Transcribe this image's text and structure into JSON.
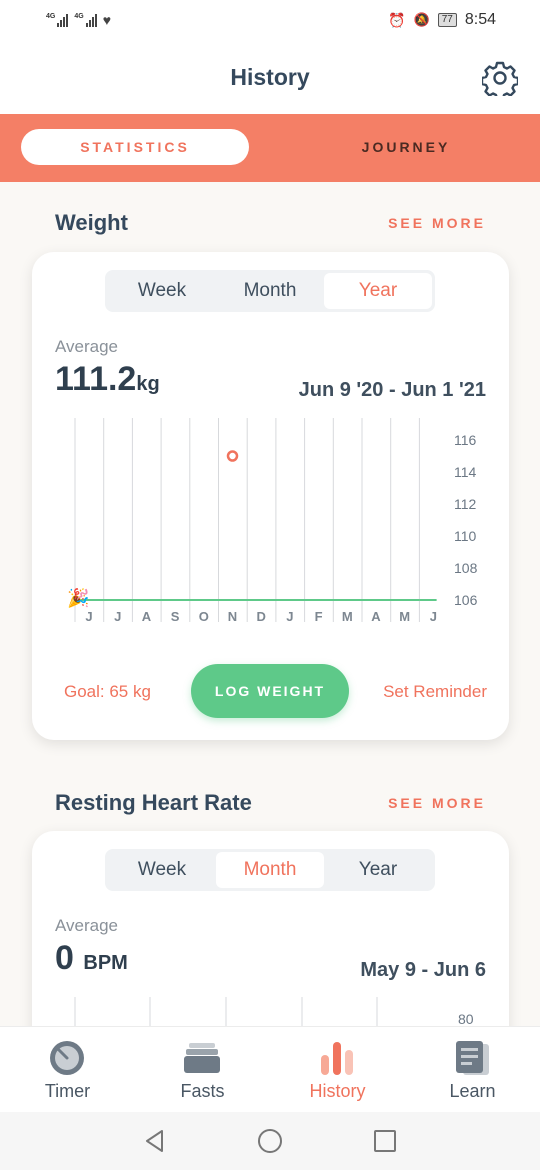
{
  "status_bar": {
    "sim1": "4G",
    "sim2": "4G",
    "battery": "77",
    "time": "8:54"
  },
  "header": {
    "title": "History"
  },
  "tabs": {
    "statistics": "STATISTICS",
    "journey": "JOURNEY"
  },
  "weight": {
    "title": "Weight",
    "see_more": "SEE MORE",
    "segments": [
      "Week",
      "Month",
      "Year"
    ],
    "selected_segment": "Year",
    "average_label": "Average",
    "average_value": "111.2",
    "average_unit": "kg",
    "date_range": "Jun 9 '20 - Jun 1 '21",
    "goal": "Goal: 65 kg",
    "log_button": "LOG WEIGHT",
    "set_reminder": "Set Reminder"
  },
  "chart_data": {
    "type": "line",
    "categories": [
      "J",
      "J",
      "A",
      "S",
      "O",
      "N",
      "D",
      "J",
      "F",
      "M",
      "A",
      "M",
      "J"
    ],
    "y_ticks": [
      116,
      114,
      112,
      110,
      108,
      106
    ],
    "ylim": [
      106,
      116
    ],
    "grid": "vertical",
    "series": [
      {
        "values": [
          106,
          106,
          106,
          106,
          106,
          106,
          106,
          106,
          106,
          106,
          106,
          106,
          106
        ],
        "color": "#5ec989"
      }
    ],
    "points": [
      {
        "x": "N",
        "y": 115
      }
    ],
    "point_color": "#f0735d"
  },
  "heart_rate": {
    "title": "Resting Heart Rate",
    "see_more": "SEE MORE",
    "segments": [
      "Week",
      "Month",
      "Year"
    ],
    "selected_segment": "Month",
    "average_label": "Average",
    "average_value": "0",
    "average_unit": "BPM",
    "date_range": "May 9 - Jun 6",
    "y_tick_top": "80"
  },
  "bottom_nav": [
    {
      "label": "Timer",
      "icon": "timer-icon",
      "active": false
    },
    {
      "label": "Fasts",
      "icon": "fasts-icon",
      "active": false
    },
    {
      "label": "History",
      "icon": "history-icon",
      "active": true
    },
    {
      "label": "Learn",
      "icon": "learn-icon",
      "active": false
    }
  ],
  "colors": {
    "accent": "#f0735d",
    "tab_bar": "#f47f66",
    "green": "#5ec989",
    "text_dark": "#35495d"
  }
}
